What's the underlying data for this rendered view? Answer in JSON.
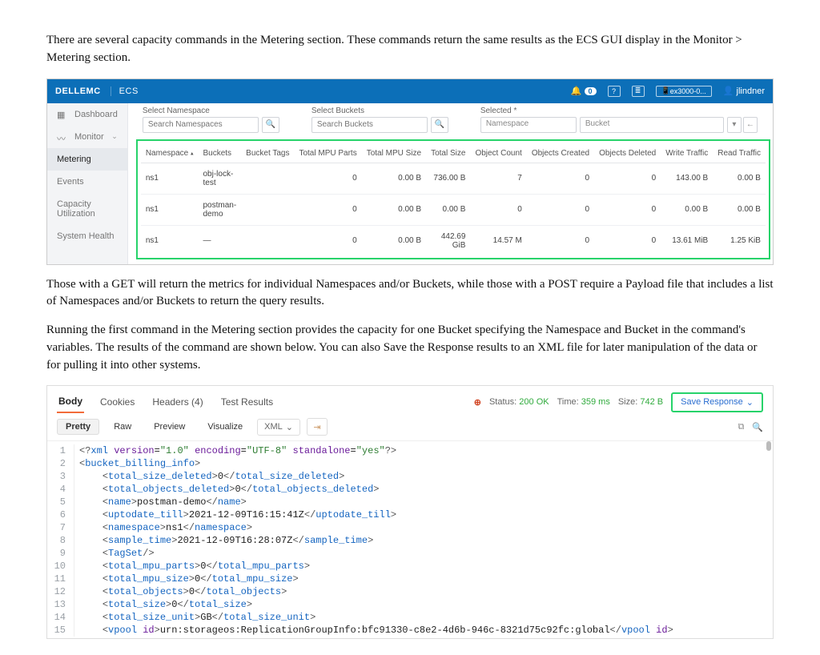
{
  "para1": "There are several capacity commands in the Metering section. These commands return the same results as the ECS GUI display in the Monitor > Metering section.",
  "para2": "Those with a GET will return the metrics for individual Namespaces and/or Buckets, while those with a POST require a Payload file that includes a list of Namespaces and/or Buckets to return the query results.",
  "para3": "Running the first command in the Metering section provides the capacity for one Bucket specifying the Namespace and Bucket in the command's variables. The results of the command are shown below. You can also Save the Response results to an XML file for later manipulation of the data or for pulling it into other systems.",
  "ecs": {
    "brand": "DELLEMC",
    "product": "ECS",
    "bell_count": "0",
    "env_label": "ex3000-0...",
    "user": "jlindner",
    "side": {
      "dashboard": "Dashboard",
      "monitor": "Monitor",
      "metering": "Metering",
      "events": "Events",
      "capacity": "Capacity Utilization",
      "system": "System Health"
    },
    "filters": {
      "ns_label": "Select Namespace",
      "ns_placeholder": "Search Namespaces",
      "bk_label": "Select Buckets",
      "bk_placeholder": "Search Buckets",
      "sel_label": "Selected *",
      "sel_ns": "Namespace",
      "sel_bk": "Bucket"
    },
    "cols": {
      "namespace": "Namespace",
      "buckets": "Buckets",
      "tags": "Bucket Tags",
      "mpu_parts": "Total MPU Parts",
      "mpu_size": "Total MPU Size",
      "total_size": "Total Size",
      "obj_count": "Object Count",
      "obj_created": "Objects Created",
      "obj_deleted": "Objects Deleted",
      "write_traffic": "Write Traffic",
      "read_traffic": "Read Traffic"
    },
    "rows": [
      {
        "ns": "ns1",
        "bucket": "obj-lock-test",
        "mpu_parts": "0",
        "mpu_size": "0.00 B",
        "total_size": "736.00 B",
        "obj_count": "7",
        "created": "0",
        "deleted": "0",
        "write": "143.00 B",
        "read": "0.00 B"
      },
      {
        "ns": "ns1",
        "bucket": "postman-demo",
        "mpu_parts": "0",
        "mpu_size": "0.00 B",
        "total_size": "0.00 B",
        "obj_count": "0",
        "created": "0",
        "deleted": "0",
        "write": "0.00 B",
        "read": "0.00 B"
      },
      {
        "ns": "ns1",
        "bucket": "—",
        "mpu_parts": "0",
        "mpu_size": "0.00 B",
        "total_size": "442.69 GiB",
        "obj_count": "14.57 M",
        "created": "0",
        "deleted": "0",
        "write": "13.61 MiB",
        "read": "1.25 KiB"
      }
    ]
  },
  "resp": {
    "tabs": {
      "body": "Body",
      "cookies": "Cookies",
      "headers": "Headers (4)",
      "tests": "Test Results"
    },
    "status_k": "Status:",
    "status_v": "200 OK",
    "time_k": "Time:",
    "time_v": "359 ms",
    "size_k": "Size:",
    "size_v": "742 B",
    "save": "Save Response",
    "sub": {
      "pretty": "Pretty",
      "raw": "Raw",
      "preview": "Preview",
      "visualize": "Visualize",
      "xml": "XML"
    },
    "xml": {
      "root": "bucket_billing_info",
      "l3_tag": "total_size_deleted",
      "l3_val": "0",
      "l4_tag": "total_objects_deleted",
      "l4_val": "0",
      "l5_tag": "name",
      "l5_val": "postman-demo",
      "l6_tag": "uptodate_till",
      "l6_val": "2021-12-09T16:15:41Z",
      "l7_tag": "namespace",
      "l7_val": "ns1",
      "l8_tag": "sample_time",
      "l8_val": "2021-12-09T16:28:07Z",
      "l9_tag": "TagSet",
      "l10_tag": "total_mpu_parts",
      "l10_val": "0",
      "l11_tag": "total_mpu_size",
      "l11_val": "0",
      "l12_tag": "total_objects",
      "l12_val": "0",
      "l13_tag": "total_size",
      "l13_val": "0",
      "l14_tag": "total_size_unit",
      "l14_val": "GB",
      "l15_tag": "vpool",
      "l15_attr": "id",
      "l15_val": "urn:storageos:ReplicationGroupInfo:bfc91330-c8e2-4d6b-946c-8321d75c92fc:global"
    }
  }
}
